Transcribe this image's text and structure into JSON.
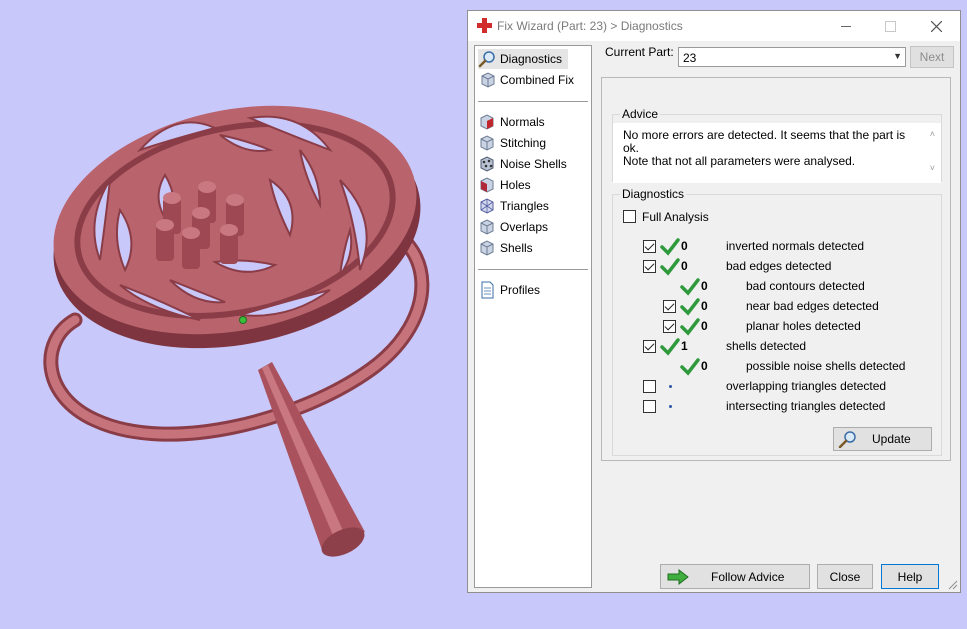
{
  "window": {
    "title": "Fix Wizard (Part: 23) > Diagnostics"
  },
  "nav": {
    "top": [
      {
        "label": "Diagnostics",
        "icon": "magnifier-icon"
      },
      {
        "label": "Combined Fix",
        "icon": "cube-icon"
      }
    ],
    "tools": [
      {
        "label": "Normals",
        "icon": "normals-cube-icon"
      },
      {
        "label": "Stitching",
        "icon": "stitching-cube-icon"
      },
      {
        "label": "Noise Shells",
        "icon": "noise-shells-icon"
      },
      {
        "label": "Holes",
        "icon": "holes-cube-icon"
      },
      {
        "label": "Triangles",
        "icon": "triangles-cube-icon"
      },
      {
        "label": "Overlaps",
        "icon": "overlaps-cube-icon"
      },
      {
        "label": "Shells",
        "icon": "shells-cube-icon"
      }
    ],
    "bottom": [
      {
        "label": "Profiles",
        "icon": "document-icon"
      }
    ]
  },
  "header": {
    "current_part_label": "Current Part:",
    "current_part_value": "23",
    "next_label": "Next"
  },
  "advice": {
    "title": "Advice",
    "line1": "No more errors are detected. It seems that the part is ok.",
    "line2": "Note that not all parameters were analysed."
  },
  "diagnostics": {
    "title": "Diagnostics",
    "full_analysis_label": "Full Analysis",
    "rows": [
      {
        "checkbox": "checked",
        "status": "ok",
        "count": "0",
        "label": "inverted normals detected"
      },
      {
        "checkbox": "checked",
        "status": "ok",
        "count": "0",
        "label": "bad edges detected"
      },
      {
        "checkbox": "none",
        "status": "ok",
        "count": "0",
        "label": "bad contours detected"
      },
      {
        "checkbox": "checked",
        "status": "ok",
        "count": "0",
        "label": "near bad edges detected"
      },
      {
        "checkbox": "checked",
        "status": "ok",
        "count": "0",
        "label": "planar holes detected"
      },
      {
        "checkbox": "checked",
        "status": "ok",
        "count": "1",
        "label": "shells detected"
      },
      {
        "checkbox": "none",
        "status": "ok",
        "count": "0",
        "label": "possible noise shells detected"
      },
      {
        "checkbox": "unchecked",
        "status": "pending",
        "count": "",
        "label": "overlapping triangles detected"
      },
      {
        "checkbox": "unchecked",
        "status": "pending",
        "count": "",
        "label": "intersecting triangles detected"
      }
    ],
    "update_label": "Update"
  },
  "footer": {
    "follow_advice_label": "Follow Advice",
    "close_label": "Close",
    "help_label": "Help"
  },
  "colors": {
    "viewport_bg": "#c9c8fb",
    "model": "#b9636d",
    "check_green": "#2e9a3c",
    "accent_blue": "#0078d7"
  }
}
